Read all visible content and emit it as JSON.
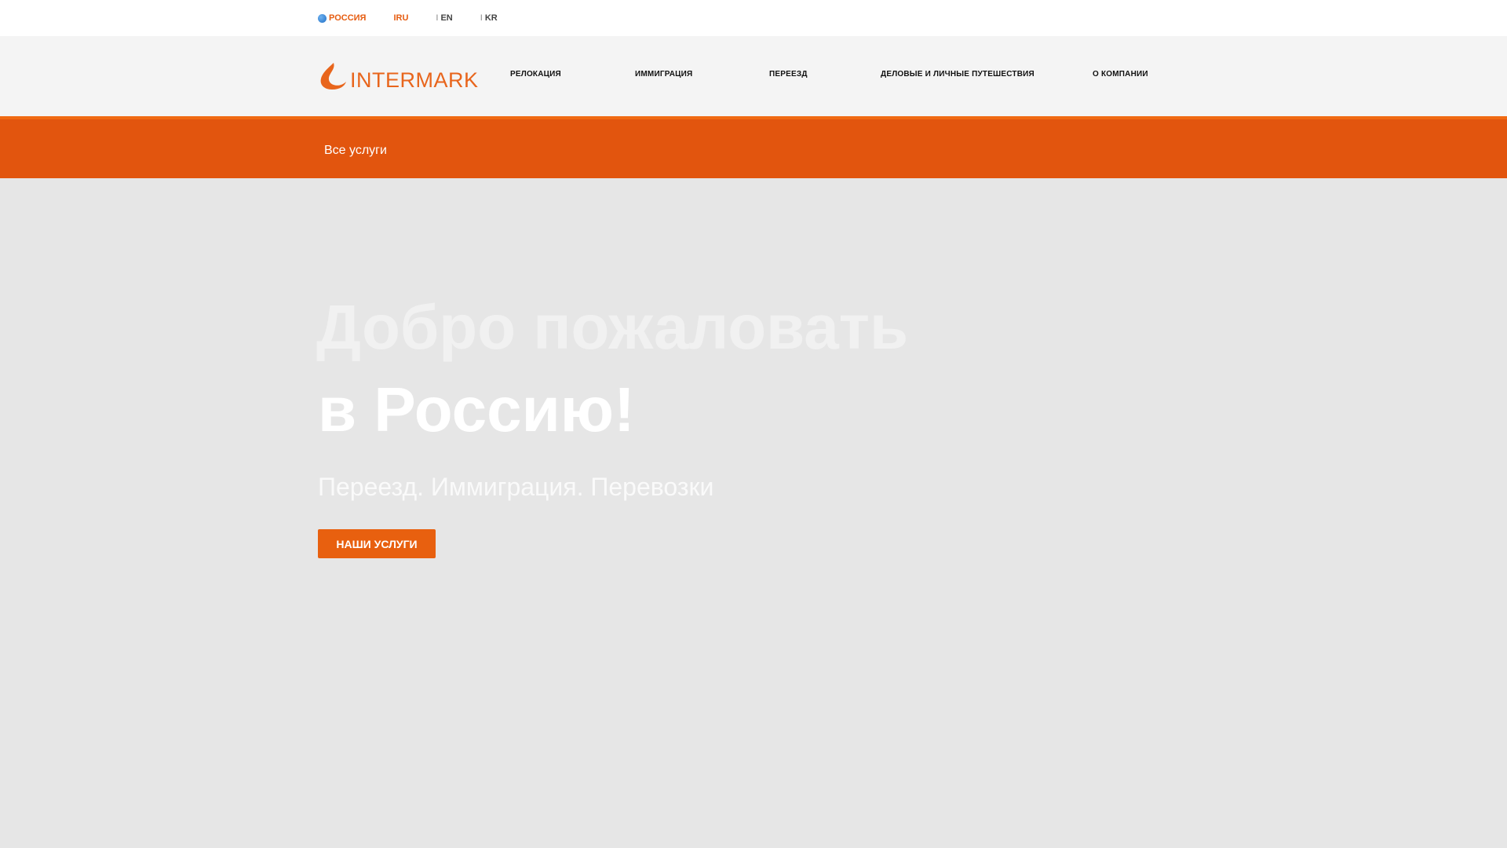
{
  "topbar": {
    "country_label": "РОССИЯ",
    "languages": [
      {
        "label": "IRU",
        "active": true
      },
      {
        "label": "EN",
        "active": false
      },
      {
        "label": "KR",
        "active": false
      }
    ],
    "separator": "I"
  },
  "header": {
    "logo_text": "INTERMARK",
    "nav": [
      "РЕЛОКАЦИЯ",
      "ИММИГРАЦИЯ",
      "ПЕРЕЕЗД",
      "ДЕЛОВЫЕ И ЛИЧНЫЕ ПУТЕШЕСТВИЯ",
      "О КОМПАНИИ"
    ]
  },
  "subbar": {
    "all_services": "Все услуги"
  },
  "hero": {
    "title_line1": "Добро пожаловать",
    "title_line2": "в Россию!",
    "subtitle": "Переезд. Иммиграция. Перевозки",
    "button_label": "НАШИ УСЛУГИ"
  },
  "colors": {
    "brand_orange": "#e2550e",
    "button_orange": "#e8600f",
    "hero_bg": "#e6e6e6"
  },
  "icons": {
    "country": "globe-icon",
    "logo": "flame-logo-icon"
  }
}
